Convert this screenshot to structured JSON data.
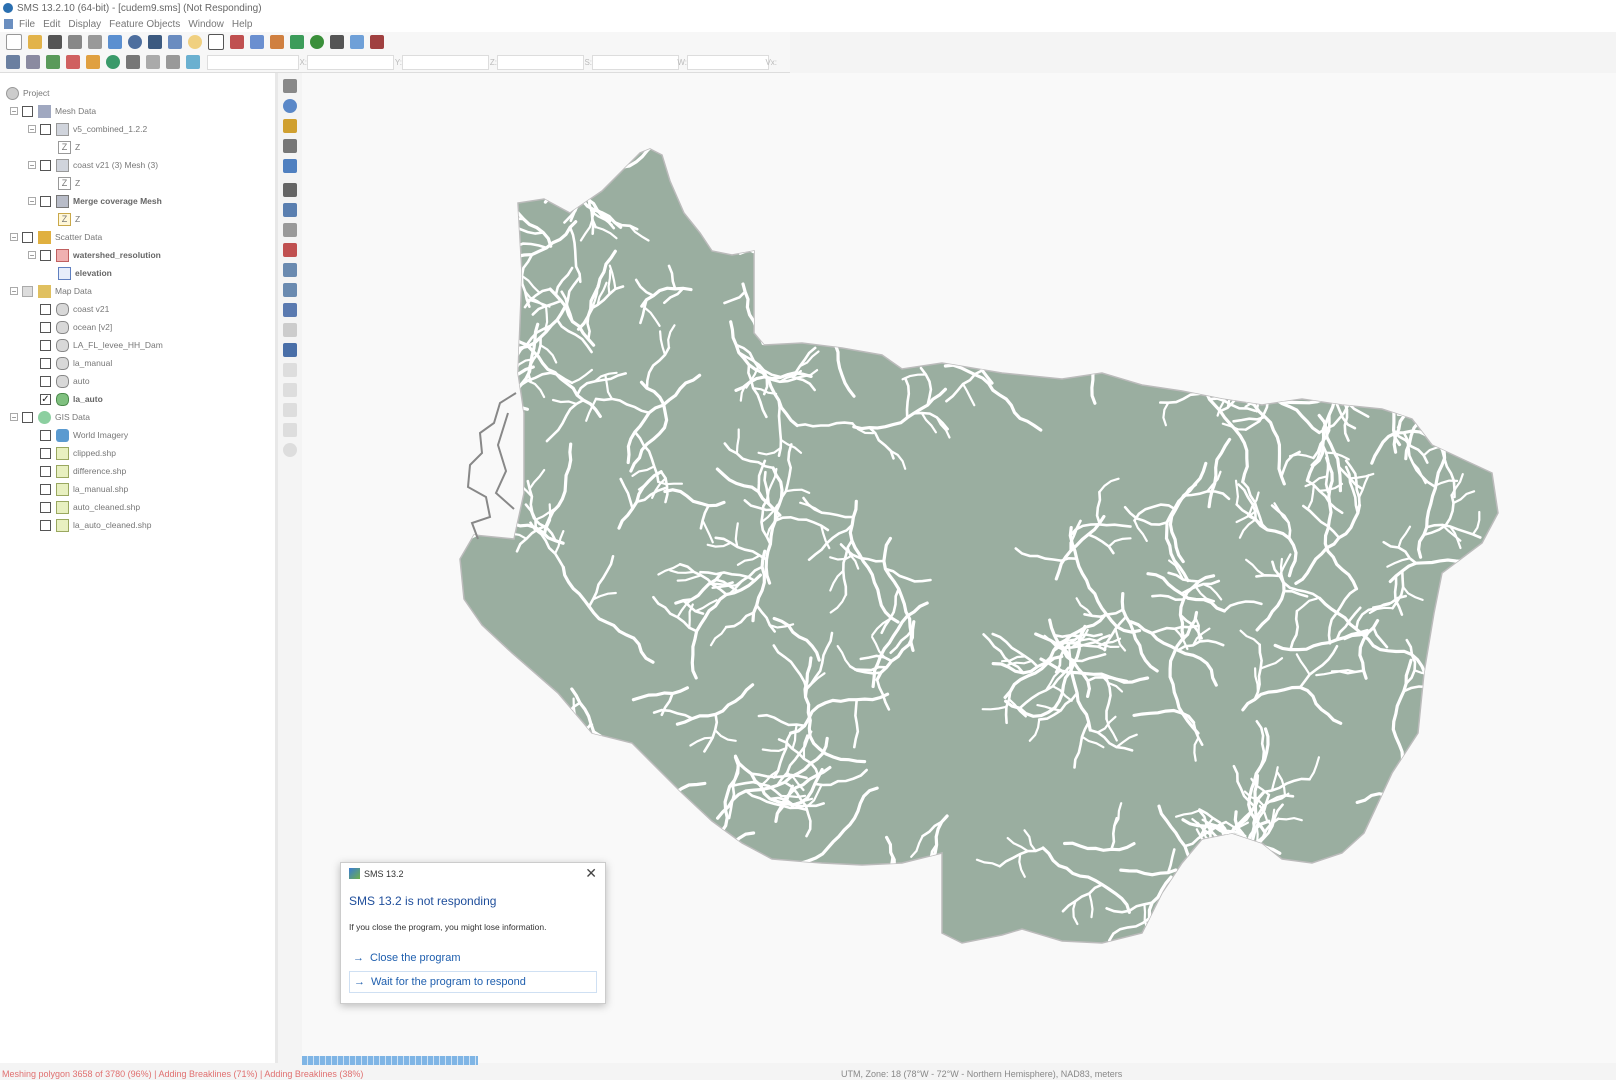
{
  "window": {
    "title": "SMS 13.2.10 (64-bit) - [cudem9.sms] (Not Responding)"
  },
  "menu": [
    "File",
    "Edit",
    "Display",
    "Feature Objects",
    "Window",
    "Help"
  ],
  "coord_fields": [
    {
      "label": "X:",
      "value": ""
    },
    {
      "label": "Y:",
      "value": ""
    },
    {
      "label": "Z:",
      "value": ""
    },
    {
      "label": "S:",
      "value": ""
    },
    {
      "label": "W:",
      "value": ""
    },
    {
      "label": "Vx:",
      "value": ""
    }
  ],
  "tree": {
    "project": "Project",
    "items": [
      {
        "label": "Mesh Data",
        "checked": false,
        "bold": false
      },
      {
        "label": "v5_combined_1.2.2",
        "checked": false,
        "bold": false
      },
      {
        "label": "Z",
        "checked": null,
        "bold": false
      },
      {
        "label": "coast v21 (3) Mesh (3)",
        "checked": false,
        "bold": false
      },
      {
        "label": "Z",
        "checked": null,
        "bold": false
      },
      {
        "label": "Merge coverage Mesh",
        "checked": false,
        "bold": true
      },
      {
        "label": "Z",
        "checked": null,
        "bold": false
      },
      {
        "label": "Scatter Data",
        "checked": false,
        "bold": false
      },
      {
        "label": "watershed_resolution",
        "checked": false,
        "bold": true
      },
      {
        "label": "elevation",
        "checked": null,
        "bold": true
      },
      {
        "label": "Map Data",
        "checked": "partial",
        "bold": false
      },
      {
        "label": "coast v21",
        "checked": false,
        "bold": false
      },
      {
        "label": "ocean [v2]",
        "checked": false,
        "bold": false
      },
      {
        "label": "LA_FL_levee_HH_Dam",
        "checked": false,
        "bold": false
      },
      {
        "label": "la_manual",
        "checked": false,
        "bold": false
      },
      {
        "label": "auto",
        "checked": false,
        "bold": false
      },
      {
        "label": "la_auto",
        "checked": true,
        "bold": true
      },
      {
        "label": "GIS Data",
        "checked": false,
        "bold": false
      },
      {
        "label": "World Imagery",
        "checked": false,
        "bold": false
      },
      {
        "label": "clipped.shp",
        "checked": false,
        "bold": false
      },
      {
        "label": "difference.shp",
        "checked": false,
        "bold": false
      },
      {
        "label": "la_manual.shp",
        "checked": false,
        "bold": false
      },
      {
        "label": "auto_cleaned.shp",
        "checked": false,
        "bold": false
      },
      {
        "label": "la_auto_cleaned.shp",
        "checked": false,
        "bold": false
      }
    ]
  },
  "map": {
    "fill_color": "#9aaea0",
    "channel_color": "#ffffff",
    "background": "#f9f9f9"
  },
  "dialog": {
    "title": "SMS 13.2",
    "heading": "SMS 13.2 is not responding",
    "message": "If you close the program, you might lose information.",
    "close_option": "Close the program",
    "wait_option": "Wait for the program to respond"
  },
  "status": {
    "left": "Meshing polygon 3658 of 3780 (96%) | Adding Breaklines (71%) | Adding Breaklines (38%)",
    "right": "UTM, Zone: 18 (78°W - 72°W - Northern Hemisphere), NAD83, meters",
    "progress_label": ""
  }
}
